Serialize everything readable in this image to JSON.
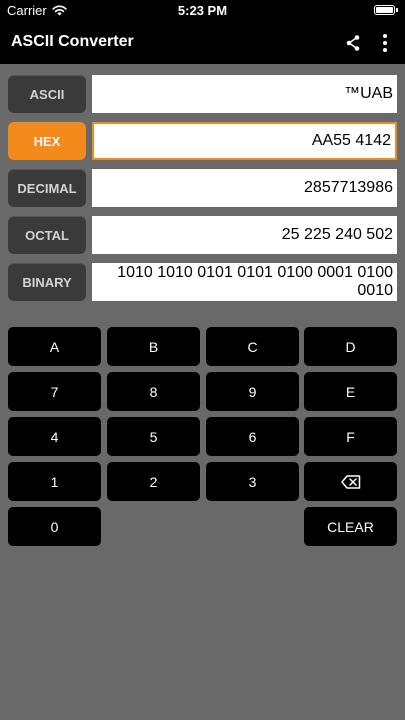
{
  "status": {
    "carrier": "Carrier",
    "time": "5:23 PM"
  },
  "app": {
    "title": "ASCII Converter"
  },
  "fields": {
    "ascii": {
      "label": "ASCII",
      "value": "™UAB"
    },
    "hex": {
      "label": "HEX",
      "value": "AA55 4142"
    },
    "decimal": {
      "label": "DECIMAL",
      "value": "2857713986"
    },
    "octal": {
      "label": "OCTAL",
      "value": "25 225 240 502"
    },
    "binary": {
      "label": "BINARY",
      "value": "1010 1010 0101 0101 0100 0001 0100 0010"
    }
  },
  "keypad": {
    "a": "A",
    "b": "B",
    "c": "C",
    "d": "D",
    "k7": "7",
    "k8": "8",
    "k9": "9",
    "e": "E",
    "k4": "4",
    "k5": "5",
    "k6": "6",
    "f": "F",
    "k1": "1",
    "k2": "2",
    "k3": "3",
    "k0": "0",
    "clear": "CLEAR"
  },
  "colors": {
    "accent": "#f28a1c",
    "background": "#696969",
    "key": "#000000"
  },
  "icons": {
    "wifi": "wifi-icon",
    "battery": "battery-icon",
    "share": "share-icon",
    "more": "more-vertical-icon",
    "backspace": "backspace-icon"
  }
}
